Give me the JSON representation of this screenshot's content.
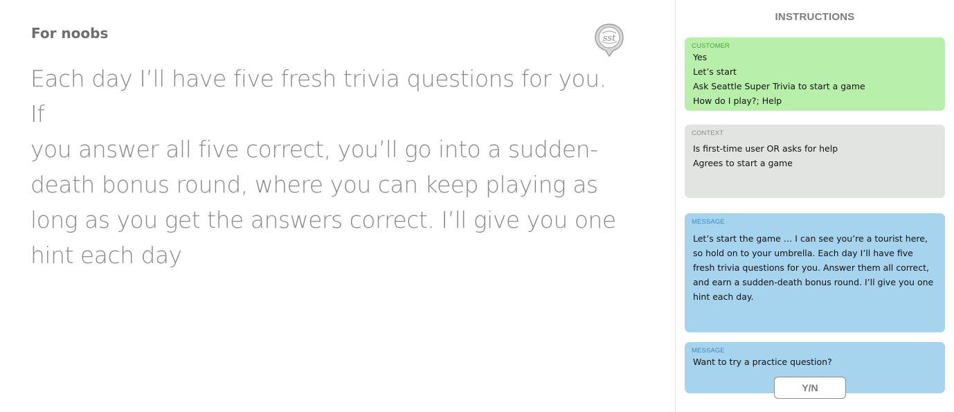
{
  "main": {
    "heading": "For noobs",
    "body_lines": [
      "Each day I’ll have five fresh trivia questions for you.  If",
      "you answer all five correct, you’ll go into a sudden-",
      "death bonus round, where you can keep playing as",
      "long as you get the answers correct. I’ll give you one",
      "hint each day"
    ],
    "logo_text": "sst"
  },
  "sidebar": {
    "title": "INSTRUCTIONS",
    "customer": {
      "label": "CUSTOMER",
      "lines": [
        "Yes",
        "Let’s start",
        "Ask Seattle Super Trivia to start a game",
        "How do I play?; Help"
      ]
    },
    "context": {
      "label": "CONTEXT",
      "lines": [
        "Is first-time user OR asks for help",
        "Agrees to start a game"
      ]
    },
    "message1": {
      "label": "MESSAGE",
      "lines": [
        "Let’s start the game … I can see you’re a tourist here,",
        "so hold on to your umbrella. Each day I’ll have five",
        "fresh trivia questions for you. Answer them all correct,",
        "and earn a sudden-death bonus round. I’ll give you one",
        "hint each day."
      ]
    },
    "message2": {
      "label": "MESSAGE",
      "lines": [
        "Want to try a practice question?"
      ]
    },
    "yn_button": "Y/N"
  },
  "colors": {
    "customer_bg": "#b8efaa",
    "context_bg": "#e1e4e0",
    "message_bg": "#a6d3ee"
  }
}
